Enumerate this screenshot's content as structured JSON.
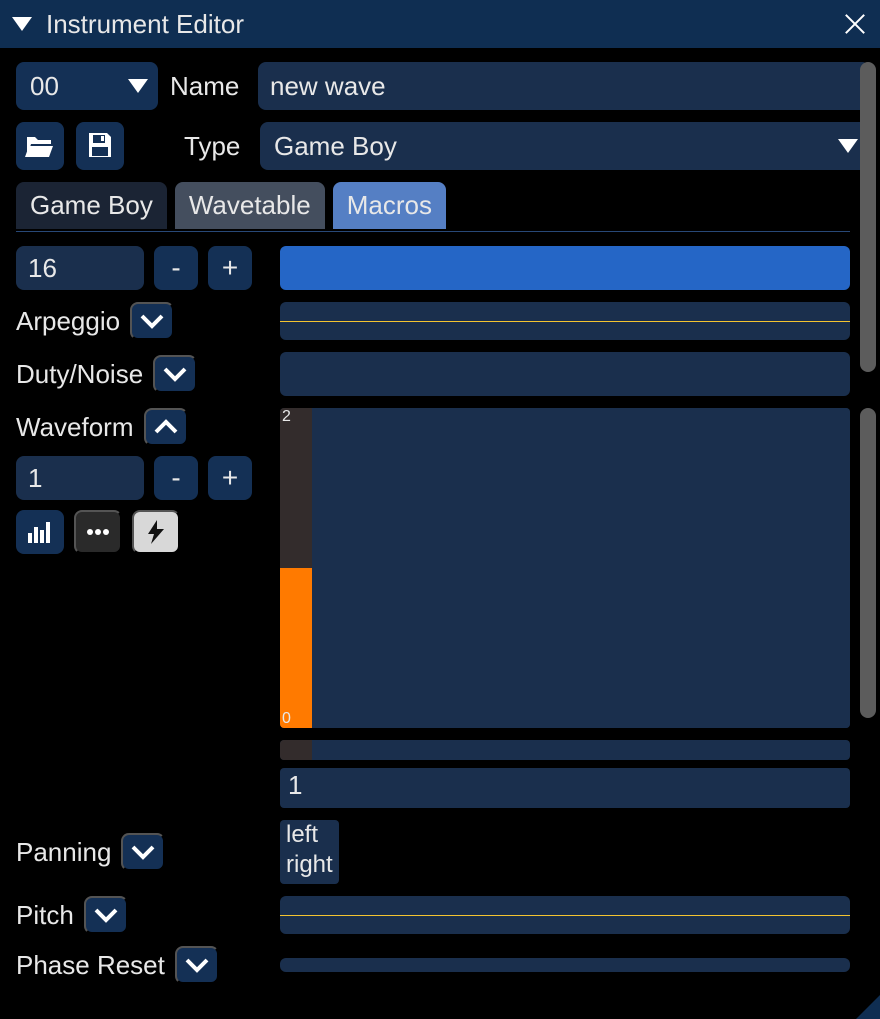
{
  "window": {
    "title": "Instrument Editor"
  },
  "header": {
    "instrument_number": "00",
    "name_label": "Name",
    "name_value": "new wave",
    "type_label": "Type",
    "type_value": "Game Boy"
  },
  "tabs": {
    "t0": "Game Boy",
    "t1": "Wavetable",
    "t2": "Macros",
    "active": 2
  },
  "macros": {
    "length_value": "16",
    "minus": "-",
    "plus": "+",
    "arpeggio_label": "Arpeggio",
    "duty_label": "Duty/Noise",
    "waveform": {
      "label": "Waveform",
      "length_value": "1",
      "top_tick": "2",
      "bottom_tick": "0",
      "sequence_value": "1"
    },
    "panning": {
      "label": "Panning",
      "left_label": "left",
      "right_label": "right"
    },
    "pitch_label": "Pitch",
    "phase_label": "Phase Reset"
  }
}
